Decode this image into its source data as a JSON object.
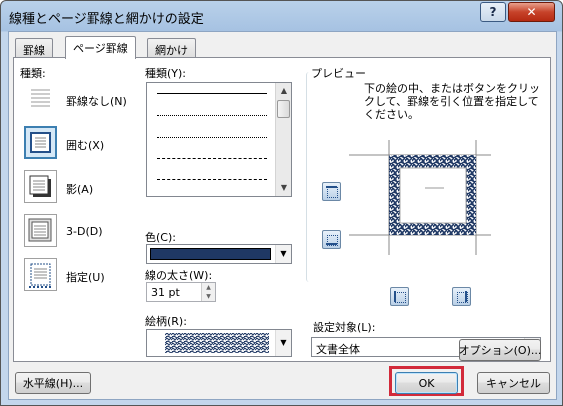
{
  "window": {
    "title": "線種とページ罫線と網かけの設定",
    "help_label": "?",
    "close_label": "✕"
  },
  "tabs": [
    {
      "label": "罫線",
      "active": false
    },
    {
      "label": "ページ罫線",
      "active": true
    },
    {
      "label": "網かけ",
      "active": false
    }
  ],
  "setting": {
    "heading": "種類:",
    "items": [
      {
        "label": "罫線なし(N)",
        "selected": false,
        "icon": "no-border-icon"
      },
      {
        "label": "囲む(X)",
        "selected": true,
        "icon": "box-border-icon"
      },
      {
        "label": "影(A)",
        "selected": false,
        "icon": "shadow-border-icon"
      },
      {
        "label": "3-D(D)",
        "selected": false,
        "icon": "3d-border-icon"
      },
      {
        "label": "指定(U)",
        "selected": false,
        "icon": "custom-border-icon"
      }
    ]
  },
  "style": {
    "heading": "種類(Y):",
    "color_label": "色(C):",
    "color_value": "#1f3864",
    "width_label": "線の太さ(W):",
    "width_value": "31 pt",
    "art_label": "絵柄(R):"
  },
  "preview": {
    "heading": "プレビュー",
    "instruction": "下の絵の中、またはボタンをクリックして、罫線を引く位置を指定してください。",
    "apply_label": "設定対象(L):",
    "apply_value": "文書全体",
    "options_label": "オプション(O)..."
  },
  "footer": {
    "horizontal_line_label": "水平線(H)...",
    "ok_label": "OK",
    "cancel_label": "キャンセル"
  }
}
